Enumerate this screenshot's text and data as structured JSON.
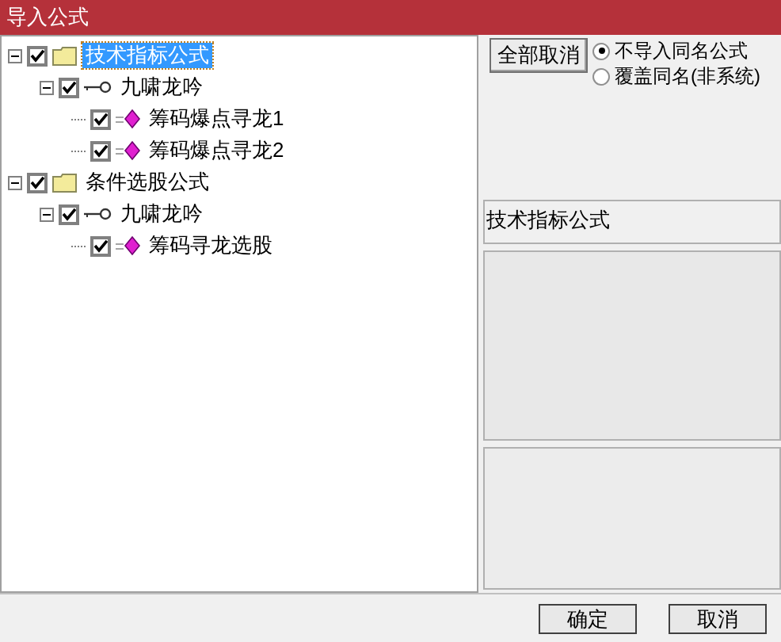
{
  "window": {
    "title": "导入公式"
  },
  "tree": [
    {
      "label": "技术指标公式",
      "kind": "folder",
      "checked": true,
      "expanded": true,
      "selected": true,
      "children": [
        {
          "label": "九啸龙吟",
          "kind": "group",
          "checked": true,
          "expanded": true,
          "selected": false,
          "children": [
            {
              "label": "筹码爆点寻龙1",
              "kind": "formula",
              "checked": true,
              "selected": false
            },
            {
              "label": "筹码爆点寻龙2",
              "kind": "formula",
              "checked": true,
              "selected": false
            }
          ]
        }
      ]
    },
    {
      "label": "条件选股公式",
      "kind": "folder",
      "checked": true,
      "expanded": true,
      "selected": false,
      "children": [
        {
          "label": "九啸龙吟",
          "kind": "group",
          "checked": true,
          "expanded": true,
          "selected": false,
          "children": [
            {
              "label": "筹码寻龙选股",
              "kind": "formula",
              "checked": true,
              "selected": false
            }
          ]
        }
      ]
    }
  ],
  "cancel_all_button": "全部取消",
  "options": [
    {
      "label": "不导入同名公式",
      "selected": true
    },
    {
      "label": "覆盖同名(非系统)",
      "selected": false
    }
  ],
  "info_label": "技术指标公式",
  "buttons": [
    "确定",
    "取消"
  ]
}
